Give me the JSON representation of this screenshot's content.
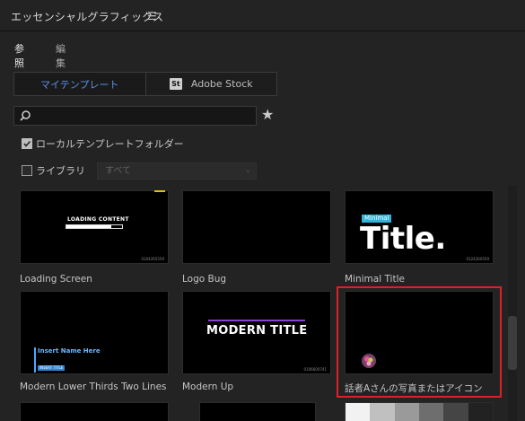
{
  "panel": {
    "title": "エッセンシャルグラフィックス",
    "menu_icon": "hamburger-menu-icon"
  },
  "subtabs": [
    {
      "label": "参照",
      "active": true
    },
    {
      "label": "編集",
      "active": false
    }
  ],
  "source_tabs": {
    "my_templates": "マイテンプレート",
    "adobe_stock": "Adobe Stock",
    "adobe_stock_badge": "St"
  },
  "search": {
    "value": "",
    "placeholder": ""
  },
  "local_folder": {
    "label": "ローカルテンプレートフォルダー",
    "checked": true
  },
  "library": {
    "label": "ライブラリ",
    "checked": false,
    "selected": "すべて"
  },
  "templates": [
    {
      "label": "Loading Screen",
      "thumb_text": "LOADING CONTENT",
      "progress": 0.8,
      "timecode": "0104265559"
    },
    {
      "label": "Logo Bug"
    },
    {
      "label": "Minimal Title",
      "thumb_small": "Minimal",
      "thumb_big": "Title.",
      "timecode": "0124260559"
    },
    {
      "label": "Modern Lower Thirds Two Lines",
      "thumb_line1": "Insert Name Here",
      "thumb_line2": "INSERT TITLE"
    },
    {
      "label": "Modern Up",
      "thumb_text": "MODERN TITLE",
      "timecode": "0106600741"
    },
    {
      "label": "話者Aさんの写真またはアイコン"
    }
  ],
  "colors": {
    "accent_blue": "#5d8ee5",
    "highlight_red": "#e01f26",
    "minimal_cyan": "#2fb4dc",
    "modern_purple": "#8b3fd6"
  }
}
